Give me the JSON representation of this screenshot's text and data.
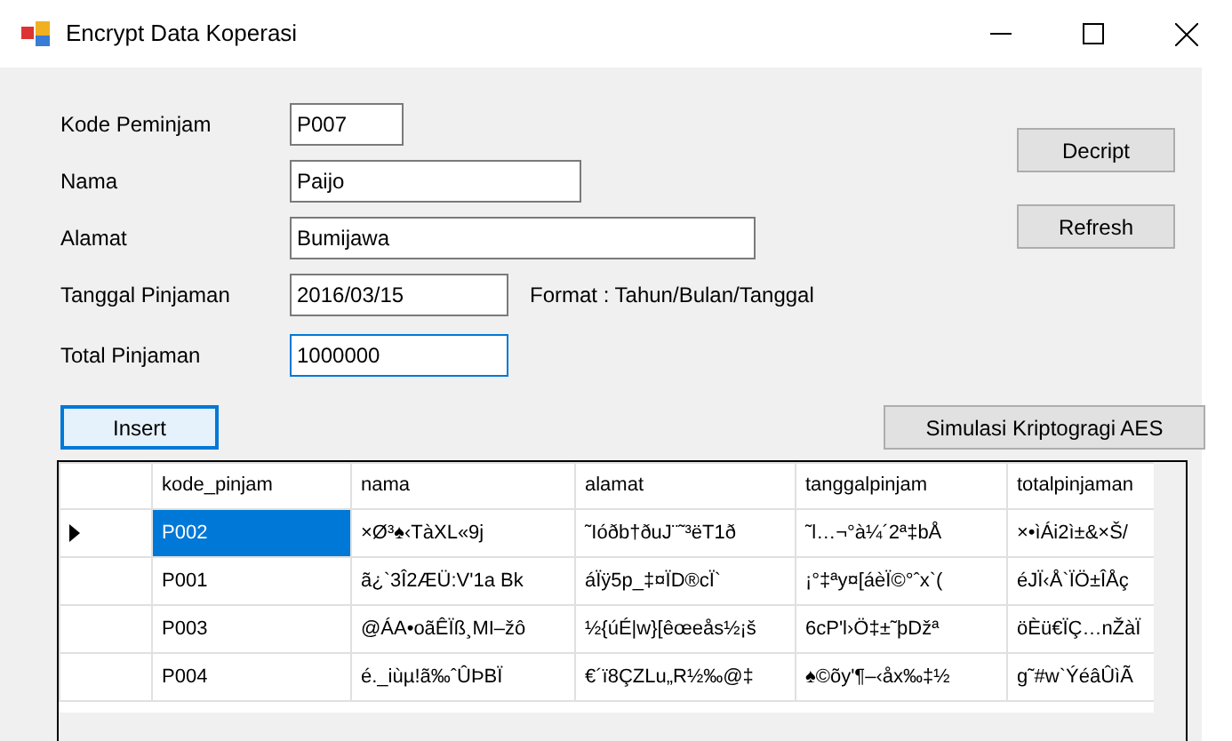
{
  "window": {
    "title": "Encrypt Data Koperasi"
  },
  "form": {
    "fields": [
      {
        "label": "Kode Peminjam",
        "value": "P007",
        "focused": false
      },
      {
        "label": "Nama",
        "value": "Paijo",
        "focused": false
      },
      {
        "label": "Alamat",
        "value": "Bumijawa",
        "focused": false
      },
      {
        "label": "Tanggal Pinjaman",
        "value": "2016/03/15",
        "focused": false
      },
      {
        "label": "Total Pinjaman",
        "value": "1000000",
        "focused": true
      }
    ],
    "format_hint": "Format : Tahun/Bulan/Tanggal"
  },
  "side_buttons": [
    "Decript",
    "Refresh"
  ],
  "insert_button": {
    "label": "Insert",
    "default": true
  },
  "simulate_button": {
    "label": "Simulasi Kriptogragi AES",
    "default": false
  },
  "table": {
    "columns": [
      "kode_pinjam",
      "nama",
      "alamat",
      "tanggalpinjam",
      "totalpinjaman"
    ],
    "rows": [
      {
        "selected": true,
        "cells": [
          "P002",
          "×Ø³♠‹TàXL«9j",
          "˜Ióðb†ðuJ¨˜³ëT1ð",
          "˜l…¬°à¼´2ª‡bÅ",
          "×•ìÁi2ì±&×Š/"
        ]
      },
      {
        "selected": false,
        "cells": [
          "P001",
          "ã¿`3Î2ÆÜ:V'1a  Bk",
          "áÏÿ5p_‡¤ÏD®cÏ`",
          "¡°‡ªy¤[áèÏ©°ˆx`(",
          "éJÏ‹Å`ÏÖ±ÎÅç"
        ]
      },
      {
        "selected": false,
        "cells": [
          "P003",
          "@ÁA•oãÊÏß¸MI–žô",
          "½{úÉ|w}[êœeås½¡š",
          "6cP'l›Ö‡±˜þDžª",
          "öÈü€ÏÇ…nŽàÏ"
        ]
      },
      {
        "selected": false,
        "cells": [
          "P004",
          "é._iùµ!ã‰ˆÛÞBÏ",
          "€´ï8ÇZLu„R½‰@‡",
          "♠©õy'¶–‹åx‰‡½",
          "g˜#w`ÝéâÛìÃ"
        ]
      }
    ]
  }
}
